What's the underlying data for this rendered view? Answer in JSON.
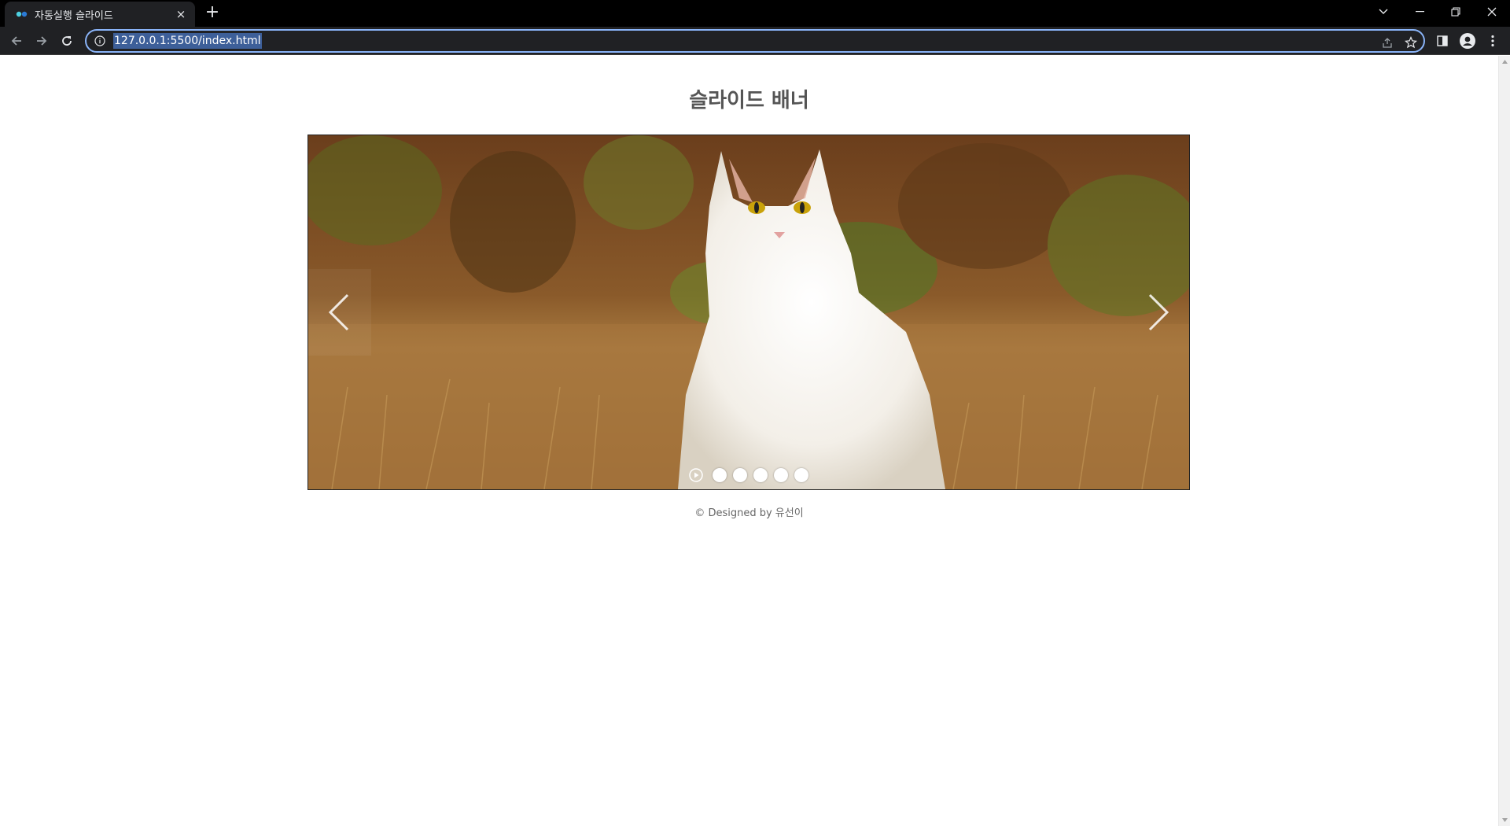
{
  "browser": {
    "tab_title": "자동실행 슬라이드",
    "tab_close": "×",
    "new_tab": "+",
    "url": "127.0.0.1:5500/index.html"
  },
  "page": {
    "title": "슬라이드 배너",
    "footer": "© Designed by 유선이"
  },
  "slider": {
    "current_slide": 1,
    "slide_count": 5,
    "image_icon": "white-cat-photo",
    "dots": [
      {
        "active": true
      },
      {
        "active": false
      },
      {
        "active": false
      },
      {
        "active": false
      },
      {
        "active": false
      }
    ]
  },
  "colors": {
    "chrome_dark": "#202124",
    "omnibox_focus": "#8ab4f8",
    "title_text": "#555555",
    "favicon": "#4dd0e1"
  }
}
